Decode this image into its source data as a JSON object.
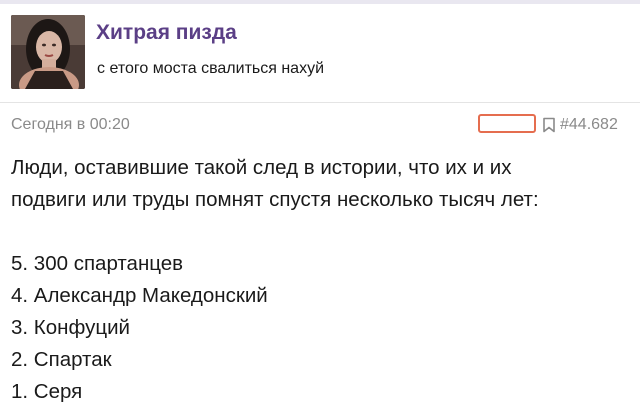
{
  "channel": {
    "title": "Хитрая пизда",
    "description": "с етого моста свалиться нахуй",
    "avatar_icon": "channel-avatar"
  },
  "post": {
    "time": "Сегодня в 00:20",
    "id": "#44.682",
    "bookmark_icon": "bookmark-icon",
    "intro_line_1": "Люди, оставившие такой след в истории, что их и их",
    "intro_line_2": "подвиги или труды помнят спустя несколько тысяч лет:",
    "list": [
      "5. 300 спартанцев",
      "4. Александр Македонский",
      "3. Конфуций",
      "2. Спартак",
      "1. Серя"
    ]
  },
  "colors": {
    "accent": "#5b3f86",
    "highlight": "#e56d4f",
    "meta_text": "#8a8a8a"
  }
}
